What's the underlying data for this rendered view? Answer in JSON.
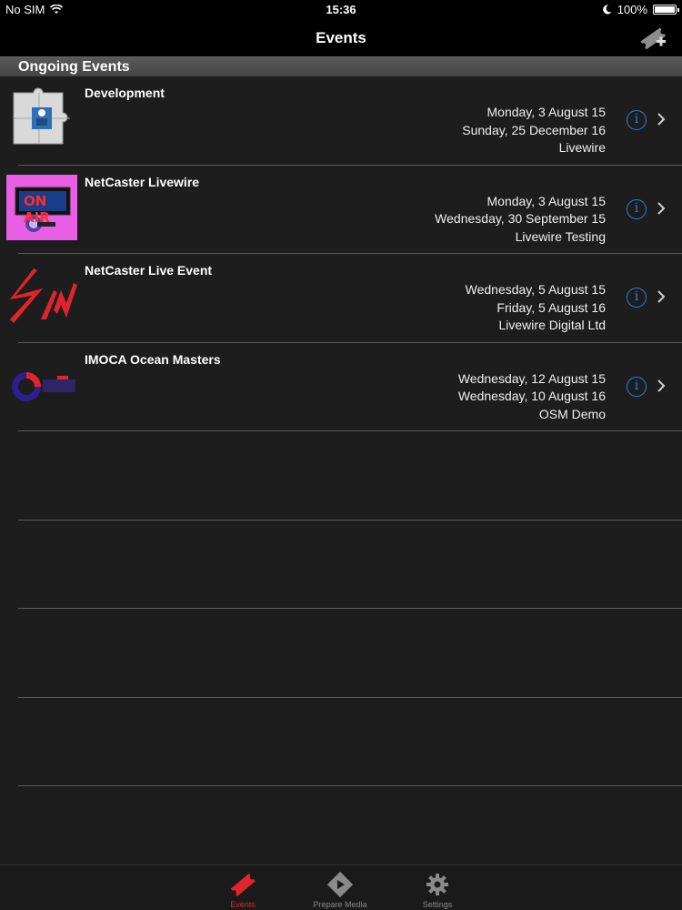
{
  "status_bar": {
    "carrier": "No SIM",
    "time": "15:36",
    "battery": "100%",
    "battery_level": 1.0
  },
  "nav": {
    "title": "Events"
  },
  "section": {
    "header": "Ongoing Events"
  },
  "events": [
    {
      "title": "Development",
      "start": "Monday, 3 August 15",
      "end": "Sunday, 25 December 16",
      "org": "Livewire"
    },
    {
      "title": "NetCaster Livewire",
      "start": "Monday, 3 August 15",
      "end": "Wednesday, 30 September 15",
      "org": "Livewire Testing"
    },
    {
      "title": "NetCaster Live Event",
      "start": "Wednesday, 5 August 15",
      "end": "Friday, 5 August 16",
      "org": "Livewire Digital Ltd"
    },
    {
      "title": "IMOCA Ocean Masters",
      "start": "Wednesday, 12 August 15",
      "end": "Wednesday, 10 August 16",
      "org": "OSM Demo"
    }
  ],
  "thumbnails": {
    "on_air_text": "ON AIR"
  },
  "info_glyph": "i",
  "tabs": [
    {
      "label": "Events",
      "icon": "ticket-icon",
      "active": true
    },
    {
      "label": "Prepare Media",
      "icon": "media-icon",
      "active": false
    },
    {
      "label": "Settings",
      "icon": "gear-icon",
      "active": false
    }
  ],
  "colors": {
    "accent": "#e3242b",
    "info_blue": "#2d7fe0",
    "list_bg": "#1d1d1d"
  }
}
